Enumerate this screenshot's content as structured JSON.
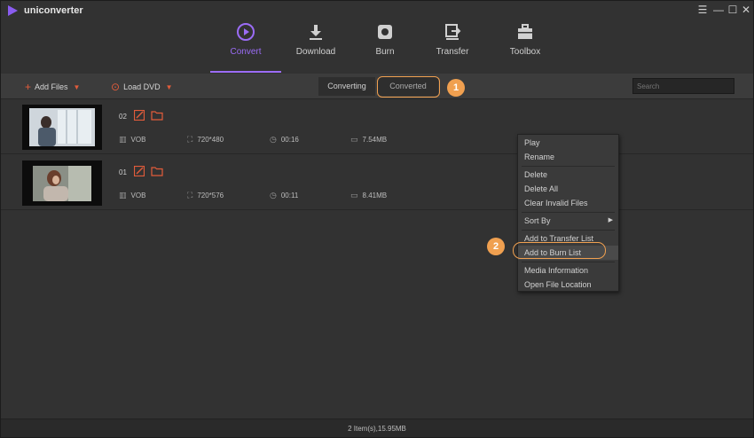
{
  "app": {
    "title": "uniconverter"
  },
  "window_controls": {
    "menu": "☰",
    "minimize": "—",
    "maximize": "☐",
    "close": "✕"
  },
  "nav": {
    "items": [
      {
        "label": "Convert",
        "icon": "play-circle-icon",
        "active": true
      },
      {
        "label": "Download",
        "icon": "download-icon",
        "active": false
      },
      {
        "label": "Burn",
        "icon": "disc-burn-icon",
        "active": false
      },
      {
        "label": "Transfer",
        "icon": "transfer-icon",
        "active": false
      },
      {
        "label": "Toolbox",
        "icon": "toolbox-icon",
        "active": false
      }
    ]
  },
  "toolbar": {
    "add_files": "Add Files",
    "load_dvd": "Load DVD",
    "tab_converting": "Converting",
    "tab_converted": "Converted",
    "search_placeholder": "Search",
    "callout_1": "1"
  },
  "files": [
    {
      "index": "02",
      "format": "VOB",
      "resolution": "720*480",
      "duration": "00:16",
      "size": "7.54MB"
    },
    {
      "index": "01",
      "format": "VOB",
      "resolution": "720*576",
      "duration": "00:11",
      "size": "8.41MB"
    }
  ],
  "context_menu": {
    "play": "Play",
    "rename": "Rename",
    "delete": "Delete",
    "delete_all": "Delete All",
    "clear_invalid": "Clear Invalid Files",
    "sort_by": "Sort By",
    "add_transfer": "Add to Transfer List",
    "add_burn": "Add to Burn List",
    "media_info": "Media Information",
    "open_location": "Open File Location",
    "callout_2": "2"
  },
  "status": {
    "summary": "2 Item(s),15.95MB"
  },
  "colors": {
    "accent": "#9b6cf6",
    "orange": "#f0a050",
    "red_icon": "#e25c3b"
  }
}
